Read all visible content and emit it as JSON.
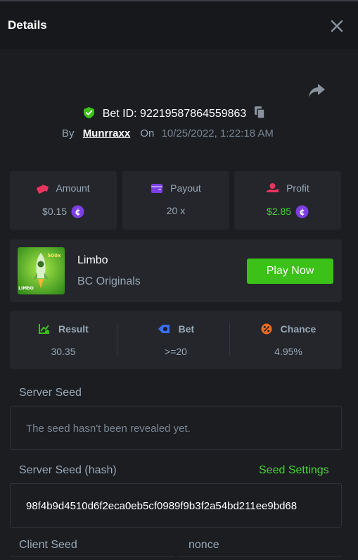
{
  "header": {
    "title": "Details"
  },
  "bet": {
    "id_label": "Bet ID: 92219587864559863",
    "by_label": "By",
    "username": "Munrraxx",
    "on_label": "On",
    "datetime": "10/25/2022, 1:22:18 AM"
  },
  "stats": [
    {
      "label": "Amount",
      "value": "$0.15",
      "icon": "amount-icon",
      "coin": true
    },
    {
      "label": "Payout",
      "value": "20 x",
      "icon": "wallet-icon",
      "coin": false
    },
    {
      "label": "Profit",
      "value": "$2.85",
      "icon": "profit-icon",
      "coin": true
    }
  ],
  "game": {
    "name": "Limbo",
    "provider": "BC Originals",
    "play_label": "Play Now",
    "thumb_badge": "500x",
    "thumb_text": "LIMBO"
  },
  "result": [
    {
      "label": "Result",
      "value": "30.35",
      "icon": "result-icon"
    },
    {
      "label": "Bet",
      "value": ">=20",
      "icon": "bet-icon"
    },
    {
      "label": "Chance",
      "value": "4.95%",
      "icon": "chance-icon"
    }
  ],
  "seeds": {
    "server_label": "Server Seed",
    "server_placeholder": "The seed hasn't been revealed yet.",
    "server_hash_label": "Server Seed (hash)",
    "seed_settings_label": "Seed Settings",
    "server_hash": "98f4b9d4510d6f2eca0eb5cf0989f9b3f2a54bd211ee9bd68",
    "client_label": "Client Seed",
    "nonce_label": "nonce"
  },
  "colors": {
    "accent_green": "#3bc117",
    "profit_green": "#43d630",
    "coin_purple": "#7b3fe4",
    "background": "#1b1d21",
    "card": "#24262b"
  }
}
